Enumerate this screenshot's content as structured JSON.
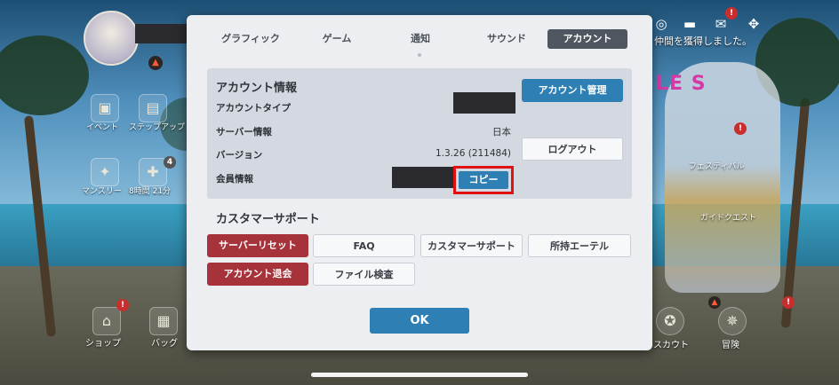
{
  "hud": {
    "event_label": "イベント",
    "stepup_label": "ステップアップ",
    "monthly_label": "マンスリー",
    "timer": "8時間 21分",
    "badge_count": "4",
    "shop_label": "ショップ",
    "bag_label": "バッグ",
    "scout_label": "スカウト",
    "adventure_label": "冒険",
    "notification": "仲間を獲得しました。",
    "festival_label": "フェスティバル",
    "guide_quest_label": "ガイドクエスト",
    "exclaim": "!",
    "banner_text": "LE S"
  },
  "dialog": {
    "tabs": [
      {
        "label": "グラフィック"
      },
      {
        "label": "ゲーム"
      },
      {
        "label": "通知"
      },
      {
        "label": "サウンド"
      },
      {
        "label": "アカウント"
      }
    ],
    "account_info": {
      "title": "アカウント情報",
      "account_type_label": "アカウントタイプ",
      "server_label": "サーバー情報",
      "server_value": "日本",
      "version_label": "バージョン",
      "version_value": "1.3.26 (211484)",
      "member_label": "会員情報",
      "copy_label": "コピー",
      "manage_label": "アカウント管理",
      "logout_label": "ログアウト"
    },
    "support": {
      "title": "カスタマーサポート",
      "server_reset": "サーバーリセット",
      "faq": "FAQ",
      "customer_support": "カスタマーサポート",
      "owned_ether": "所持エーテル",
      "account_delete": "アカウント退会",
      "file_check": "ファイル検査"
    },
    "ok_label": "OK"
  },
  "colors": {
    "accent_blue": "#2e7fb3",
    "danger_red": "#a6333a",
    "highlight_red": "#e01111"
  }
}
